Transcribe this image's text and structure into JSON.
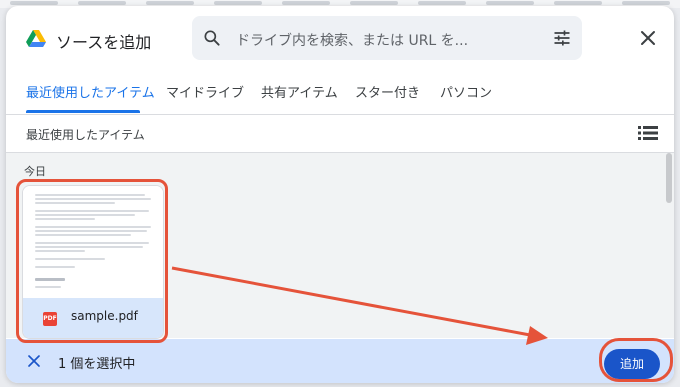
{
  "header": {
    "title": "ソースを追加",
    "search_placeholder": "ドライブ内を検索、または URL を..."
  },
  "tabs": [
    {
      "label": "最近使用したアイテム",
      "active": true
    },
    {
      "label": "マイドライブ"
    },
    {
      "label": "共有アイテム"
    },
    {
      "label": "スター付き"
    },
    {
      "label": "パソコン"
    }
  ],
  "section": {
    "title": "最近使用したアイテム"
  },
  "content": {
    "date_group": "今日",
    "files": [
      {
        "name": "sample.pdf",
        "type_badge": "PDF",
        "selected": true
      }
    ]
  },
  "footer": {
    "selection_text": "1 個を選択中",
    "add_label": "追加"
  },
  "colors": {
    "accent": "#1a73e8",
    "annotation": "#e5533a",
    "selection_bar": "#d3e3fd",
    "add_button": "#1a55c9"
  }
}
